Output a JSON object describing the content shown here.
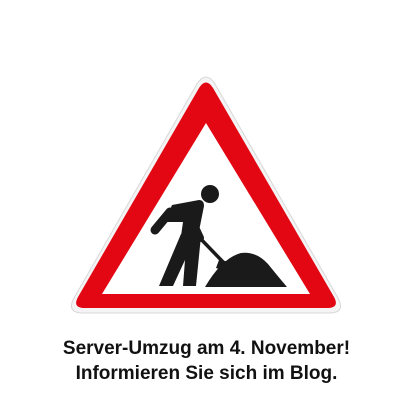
{
  "sign": {
    "icon": "roadworks-warning-sign-icon",
    "border_color": "#e30613",
    "field_color": "#ffffff",
    "symbol_color": "#1a1a1a"
  },
  "notice": {
    "line1": "Server-Umzug am 4. November!",
    "line2": "Informieren Sie sich im Blog."
  }
}
